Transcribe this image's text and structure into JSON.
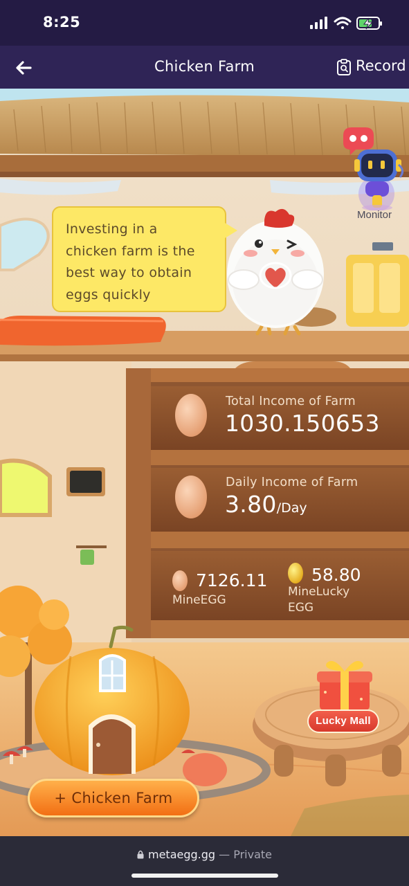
{
  "status_bar": {
    "time": "8:25"
  },
  "nav": {
    "title": "Chicken Farm",
    "record_label": "Record"
  },
  "scene": {
    "speech_bubble": {
      "line1": "Investing in a",
      "line2": "chicken farm is the",
      "line3": "best way to obtain",
      "line4": "eggs quickly"
    },
    "monitor_label": "Monitor",
    "total_income": {
      "label": "Total Income of Farm",
      "value": "1030.150653"
    },
    "daily_income": {
      "label": "Daily Income of Farm",
      "value": "3.80",
      "unit": "/Day"
    },
    "mine_egg": {
      "value": "7126.11",
      "label": "MineEGG"
    },
    "mine_lucky_egg": {
      "value": "58.80",
      "label_line1": "MineLucky",
      "label_line2": "EGG"
    },
    "lucky_mall_label": "Lucky Mall",
    "add_farm_label": "+ Chicken Farm"
  },
  "browser": {
    "domain": "metaegg.gg",
    "separator": "—",
    "mode": "Private"
  },
  "colors": {
    "status_bg": "#241b44",
    "nav_bg": "#2f2456",
    "bubble": "#fde866",
    "button_orange": "#f26f14",
    "lucky_red": "#d8392c"
  }
}
